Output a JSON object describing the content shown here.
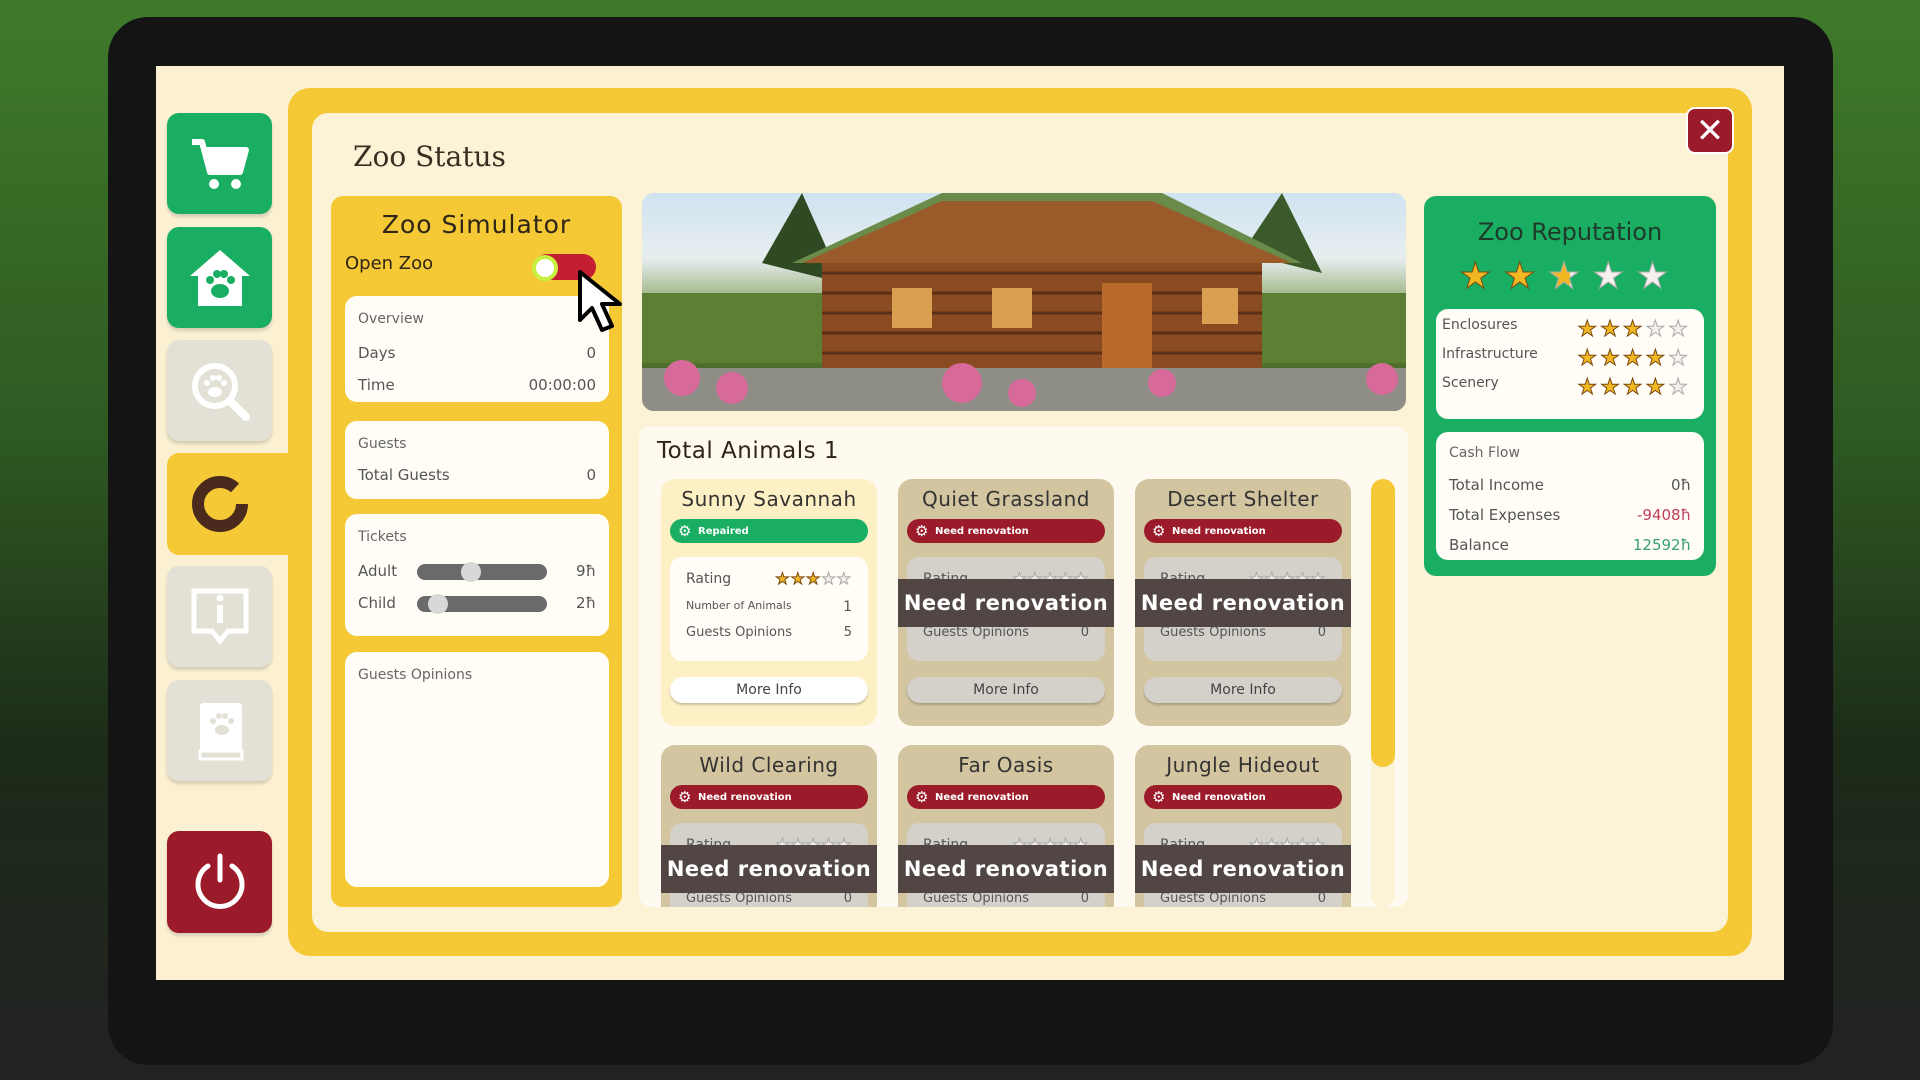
{
  "colors": {
    "accent_yellow": "#f4c935",
    "green": "#1aae62",
    "red": "#9c1b2b",
    "star": "#f2b824"
  },
  "sidebar": {
    "items": [
      {
        "name": "shop",
        "icon": "cart-icon"
      },
      {
        "name": "zoo",
        "icon": "paw-house-icon"
      },
      {
        "name": "search",
        "icon": "paw-search-icon"
      },
      {
        "name": "status",
        "icon": "ring-chart-icon",
        "active": true
      },
      {
        "name": "info",
        "icon": "info-bubble-icon"
      },
      {
        "name": "encyclopedia",
        "icon": "paw-book-icon"
      }
    ],
    "power": "power-icon"
  },
  "window": {
    "title": "Zoo Status",
    "close": "close-icon"
  },
  "left": {
    "title": "Zoo Simulator",
    "open_zoo_label": "Open Zoo",
    "open_zoo_on": false,
    "overview": {
      "heading": "Overview",
      "days_label": "Days",
      "days": "0",
      "time_label": "Time",
      "time": "00:00:00"
    },
    "guests": {
      "heading": "Guests",
      "total_label": "Total Guests",
      "total": "0"
    },
    "tickets": {
      "heading": "Tickets",
      "adult_label": "Adult",
      "adult": "9ħ",
      "adult_level": 0.4,
      "child_label": "Child",
      "child": "2ħ",
      "child_level": 0.1
    },
    "opinions": {
      "heading": "Guests Opinions"
    }
  },
  "animals": {
    "title": "Total Animals 1",
    "rating_label": "Rating",
    "count_label": "Number of Animals",
    "opinions_label": "Guests Opinions",
    "more_info": "More Info",
    "cards": [
      {
        "name": "Sunny Savannah",
        "status": "Repaired",
        "ok": true,
        "rating": 3,
        "animals": "1",
        "opinions": "5"
      },
      {
        "name": "Quiet Grassland",
        "status": "Need renovation",
        "ok": false,
        "overlay": "Need renovation",
        "rating": 0,
        "opinions": "0"
      },
      {
        "name": "Desert Shelter",
        "status": "Need renovation",
        "ok": false,
        "overlay": "Need renovation",
        "rating": 0,
        "opinions": "0"
      },
      {
        "name": "Wild Clearing",
        "status": "Need renovation",
        "ok": false,
        "overlay": "Need renovation",
        "rating": 0,
        "opinions": "0"
      },
      {
        "name": "Far Oasis",
        "status": "Need renovation",
        "ok": false,
        "overlay": "Need renovation",
        "rating": 0,
        "opinions": "0"
      },
      {
        "name": "Jungle Hideout",
        "status": "Need renovation",
        "ok": false,
        "overlay": "Need renovation",
        "rating": 0,
        "opinions": "0"
      }
    ]
  },
  "reputation": {
    "title": "Zoo Reputation",
    "stars": 2.5,
    "categories": [
      {
        "label": "Enclosures",
        "stars": 3
      },
      {
        "label": "Infrastructure",
        "stars": 4
      },
      {
        "label": "Scenery",
        "stars": 4
      }
    ],
    "cash": {
      "heading": "Cash Flow",
      "income_label": "Total Income",
      "income": "0ħ",
      "expenses_label": "Total Expenses",
      "expenses": "-9408ħ",
      "balance_label": "Balance",
      "balance": "12592ħ"
    }
  }
}
